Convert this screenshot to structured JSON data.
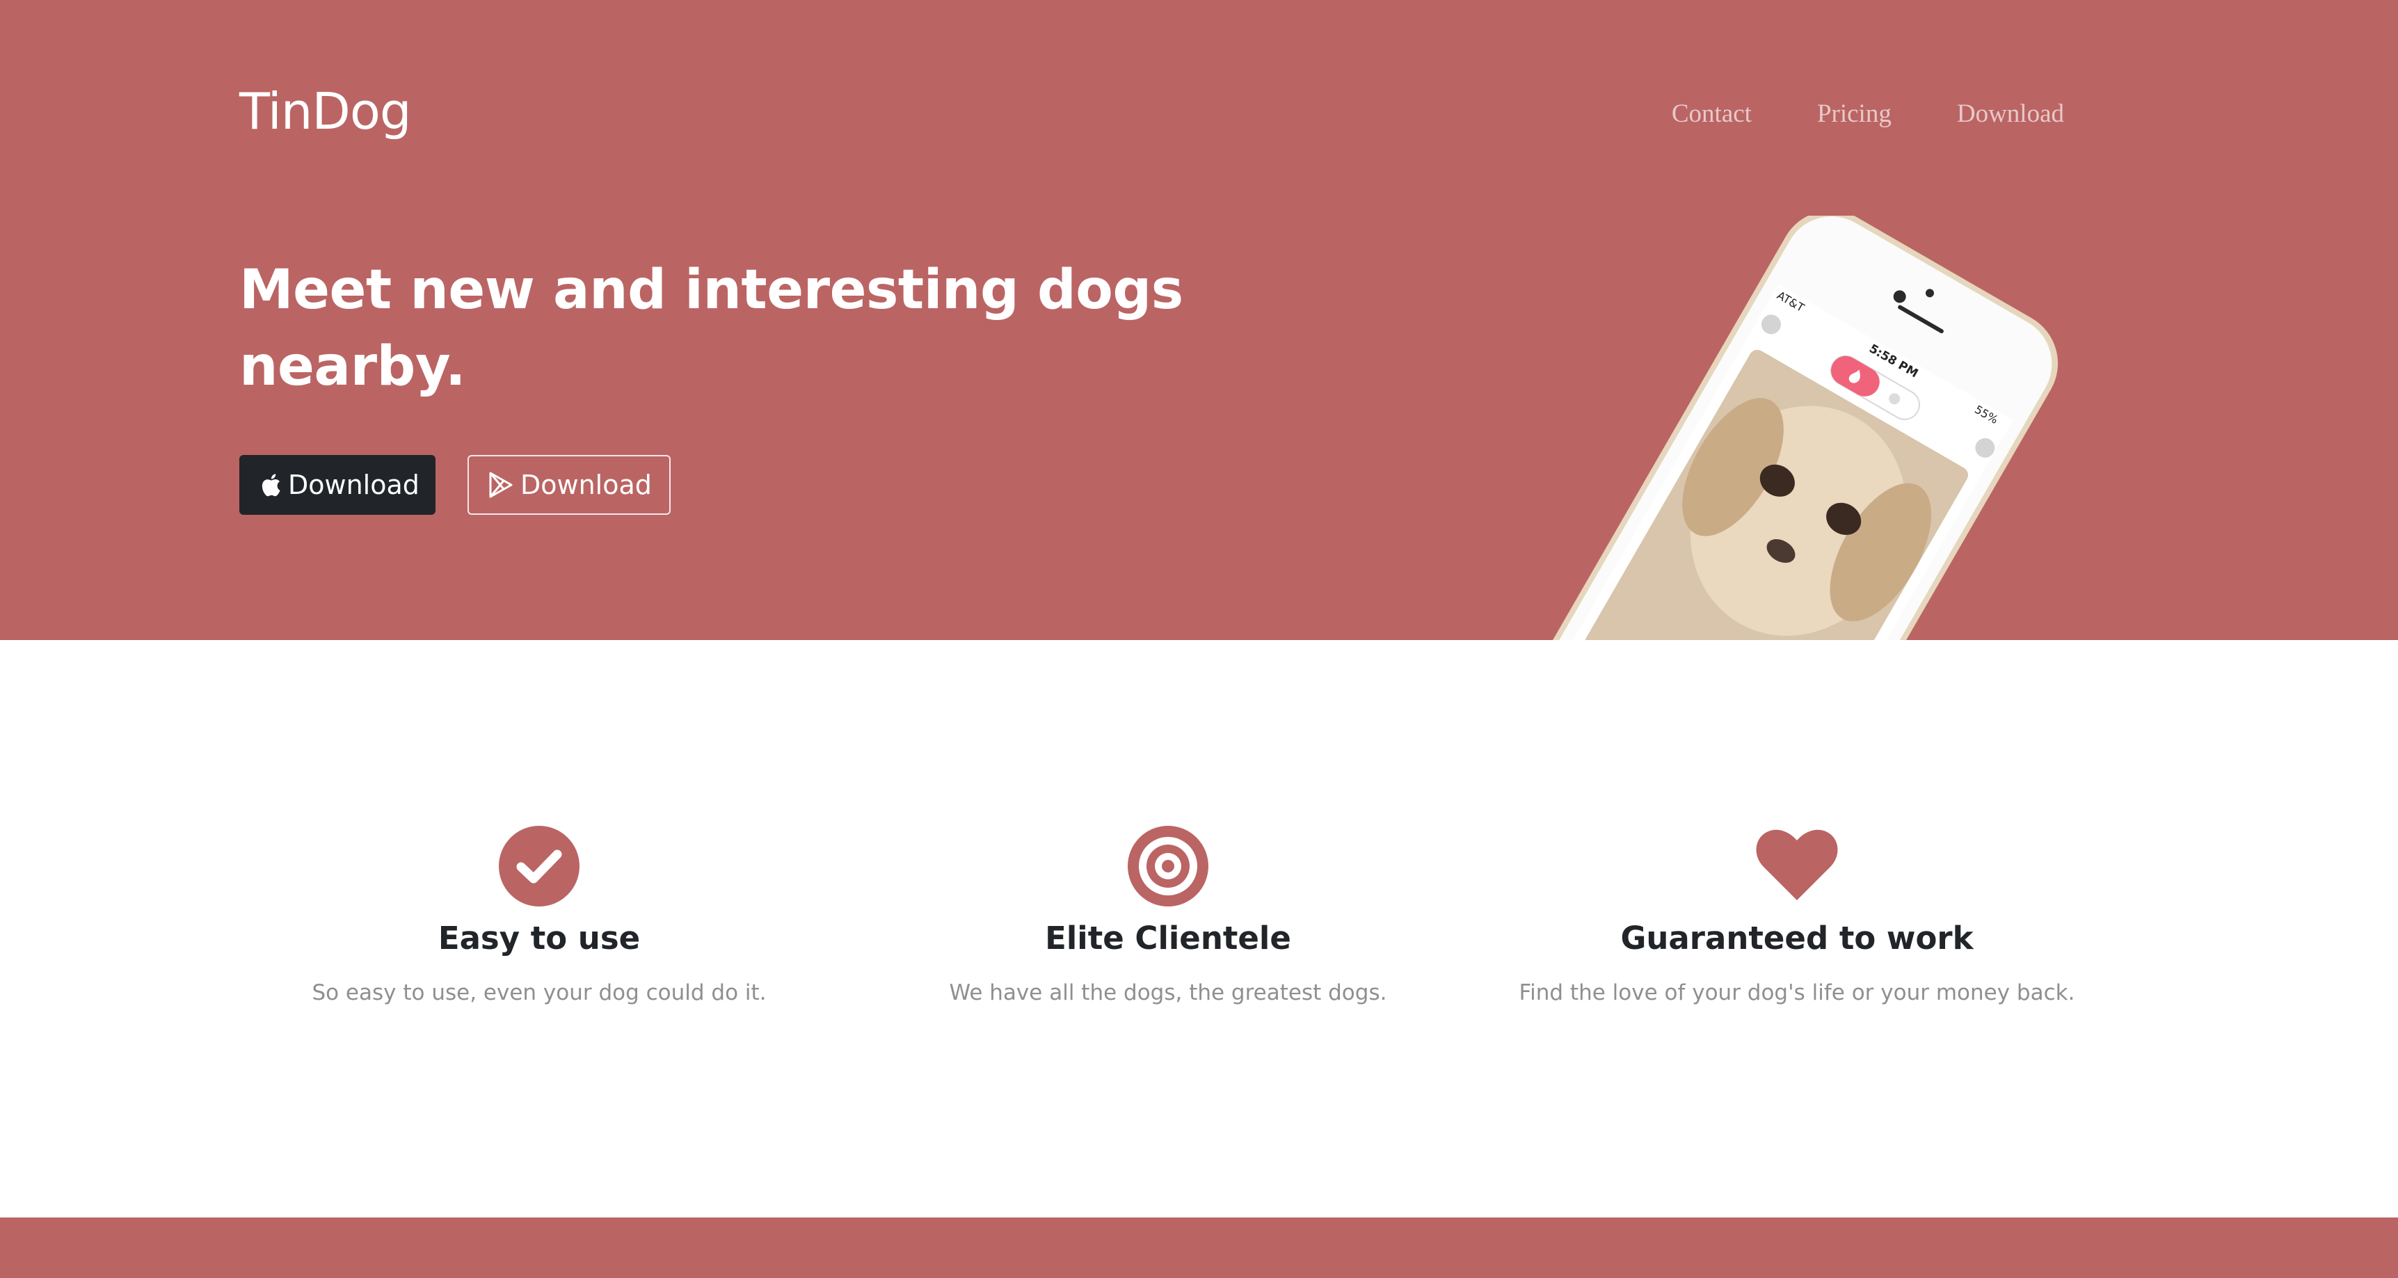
{
  "brand": "TinDog",
  "nav": {
    "contact": "Contact",
    "pricing": "Pricing",
    "download": "Download"
  },
  "hero": {
    "headline": "Meet new and interesting dogs nearby.",
    "apple_button": "Download",
    "google_button": "Download"
  },
  "phone": {
    "carrier": "AT&T",
    "time": "5:58 PM",
    "battery": "55%"
  },
  "features": [
    {
      "icon": "check-circle-icon",
      "title": "Easy to use",
      "text": "So easy to use, even your dog could do it."
    },
    {
      "icon": "bullseye-icon",
      "title": "Elite Clientele",
      "text": "We have all the dogs, the greatest dogs."
    },
    {
      "icon": "heart-icon",
      "title": "Guaranteed to work",
      "text": "Find the love of your dog's life or your money back."
    }
  ],
  "colors": {
    "brand": "#bb6464",
    "dark_button": "#212529",
    "heading": "#212529",
    "muted_text": "#8f8f8f"
  }
}
